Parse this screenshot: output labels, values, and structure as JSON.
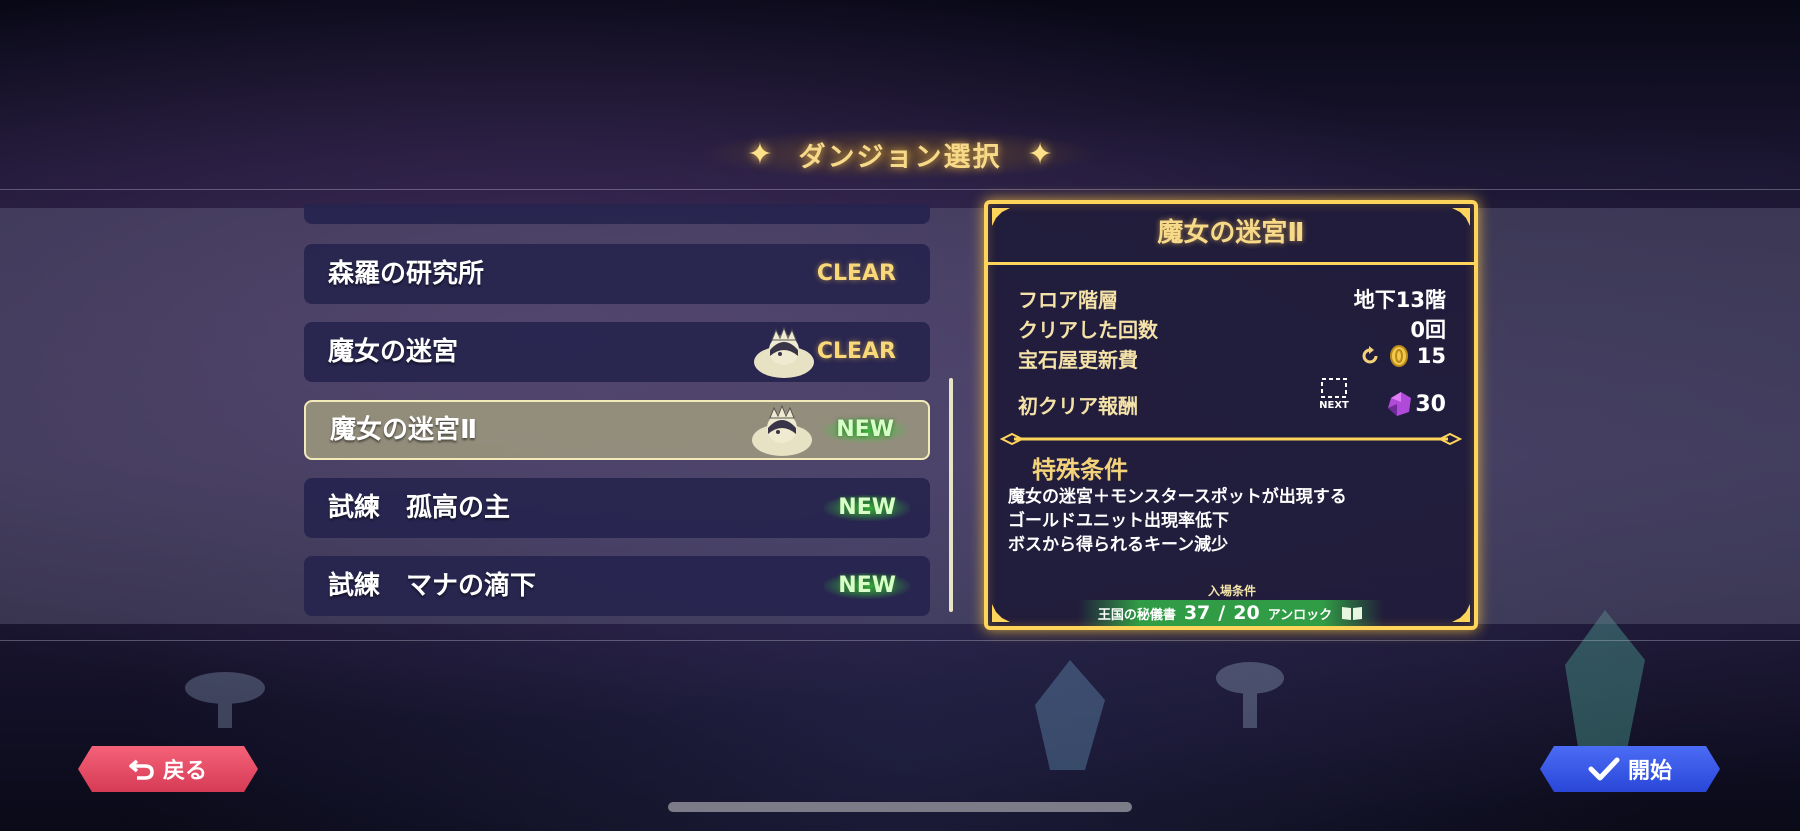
{
  "header": {
    "title": "ダンジョン選択"
  },
  "dungeon_list": {
    "items": [
      {
        "label": "森羅の研究所",
        "status": "CLEAR",
        "has_icon": false,
        "selected": false
      },
      {
        "label": "魔女の迷宮",
        "status": "CLEAR",
        "has_icon": true,
        "selected": false
      },
      {
        "label": "魔女の迷宮Ⅱ",
        "status": "NEW",
        "has_icon": true,
        "selected": true
      },
      {
        "label": "試練　孤高の主",
        "status": "NEW",
        "has_icon": false,
        "selected": false
      },
      {
        "label": "試練　マナの滴下",
        "status": "NEW",
        "has_icon": false,
        "selected": false
      }
    ]
  },
  "detail": {
    "title": "魔女の迷宮Ⅱ",
    "rows": [
      {
        "label": "フロア階層",
        "value": "地下13階"
      },
      {
        "label": "クリアした回数",
        "value": "0回"
      },
      {
        "label": "宝石屋更新費",
        "value": "15"
      },
      {
        "label": "初クリア報酬",
        "value": "30"
      }
    ],
    "next_label": "NEXT",
    "conditions_title": "特殊条件",
    "conditions": [
      "魔女の迷宮＋モンスタースポットが出現する",
      "ゴールドユニット出現率低下",
      "ボスから得られるキーン減少"
    ],
    "entry": {
      "label": "入場条件",
      "item": "王国の秘儀書",
      "current": "37",
      "separator": "/",
      "required": "20",
      "status": "アンロック"
    }
  },
  "buttons": {
    "back": "戻る",
    "start": "開始"
  },
  "colors": {
    "gold": "#ffd45a",
    "back_button": "#e84a63",
    "start_button": "#3a5ae6",
    "new_badge": "#3cc83c"
  }
}
